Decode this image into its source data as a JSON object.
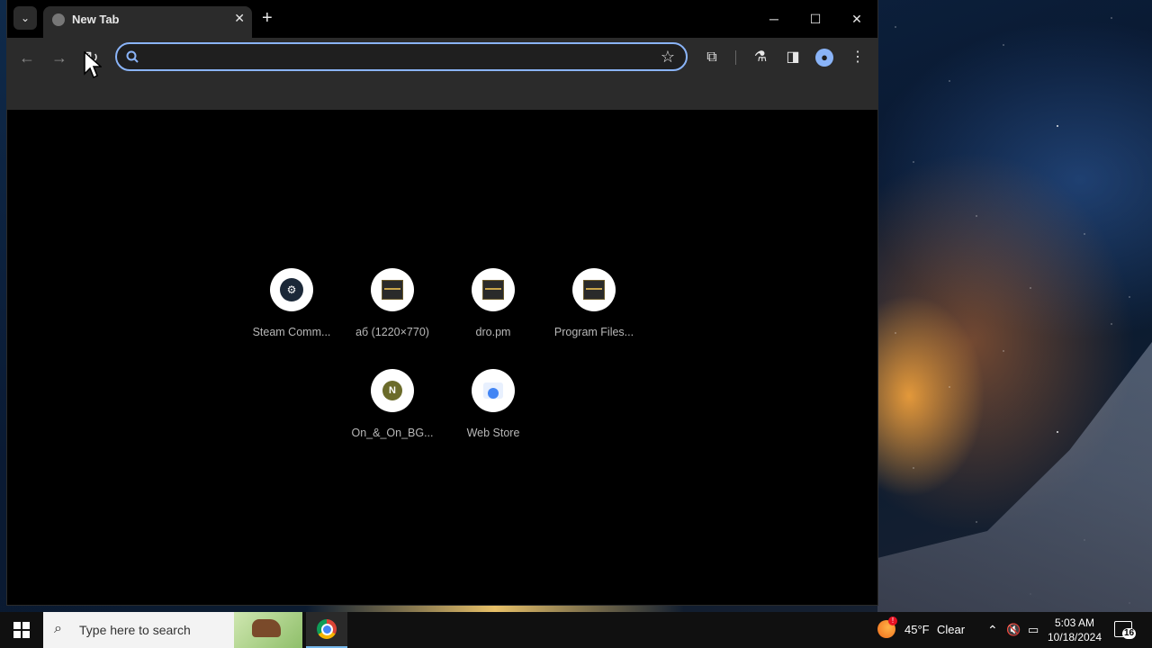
{
  "browser": {
    "tab": {
      "title": "New Tab"
    },
    "omnibox": {
      "value": "",
      "placeholder": ""
    },
    "icons": {
      "tab_search": "chevron-down-icon",
      "tab_close": "close-icon",
      "new_tab": "plus-icon",
      "back": "arrow-left-icon",
      "forward": "arrow-right-icon",
      "reload": "reload-icon",
      "search": "search-icon",
      "bookmark": "star-icon",
      "extensions": "puzzle-icon",
      "labs": "flask-icon",
      "side_panel": "side-panel-icon",
      "profile": "profile-icon",
      "menu": "kebab-menu-icon"
    },
    "accent_color": "#8ab4f8"
  },
  "shortcuts": [
    {
      "label": "Steam Comm...",
      "icon": "steam-icon"
    },
    {
      "label": "аб (1220×770)",
      "icon": "image-thumbnail-icon"
    },
    {
      "label": "dro.pm",
      "icon": "image-thumbnail-icon"
    },
    {
      "label": "Program Files...",
      "icon": "image-thumbnail-icon"
    },
    {
      "label": "On_&_On_BG...",
      "icon": "n-letter-icon",
      "letter": "N"
    },
    {
      "label": "Web Store",
      "icon": "web-store-icon"
    }
  ],
  "taskbar": {
    "search_placeholder": "Type here to search",
    "weather": {
      "temp": "45°F",
      "condition": "Clear",
      "alert_badge": "!"
    },
    "clock": {
      "time": "5:03 AM",
      "date": "10/18/2024"
    },
    "notifications_count": "16"
  }
}
